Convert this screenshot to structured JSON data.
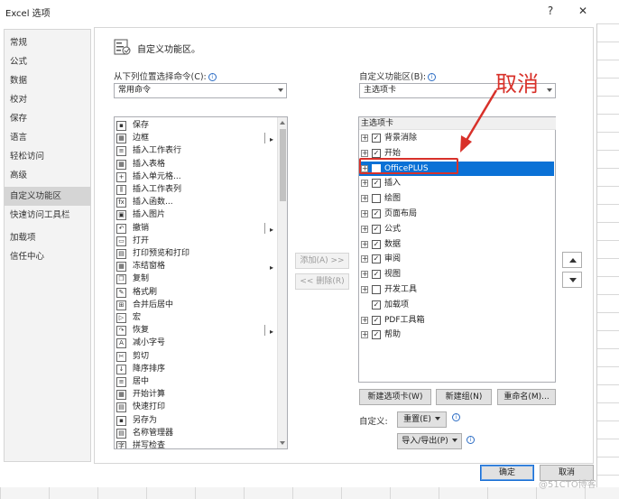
{
  "window": {
    "title": "Excel 选项",
    "help": "?",
    "close": "✕"
  },
  "nav": {
    "items": [
      {
        "label": "常规"
      },
      {
        "label": "公式"
      },
      {
        "label": "数据"
      },
      {
        "label": "校对"
      },
      {
        "label": "保存"
      },
      {
        "label": "语言"
      },
      {
        "label": "轻松访问"
      },
      {
        "label": "高级"
      },
      {
        "label": "自定义功能区",
        "active": true
      },
      {
        "label": "快速访问工具栏"
      },
      {
        "label": "加载项"
      },
      {
        "label": "信任中心"
      }
    ]
  },
  "header": {
    "title": "自定义功能区。"
  },
  "left_panel": {
    "label": "从下列位置选择命令(C):",
    "select_value": "常用命令",
    "commands": [
      {
        "label": "保存",
        "icon": "save-icon",
        "glyph": "▪"
      },
      {
        "label": "边框",
        "icon": "border-icon",
        "glyph": "▦",
        "split": true
      },
      {
        "label": "插入工作表行",
        "icon": "insert-row-icon",
        "glyph": "≡"
      },
      {
        "label": "插入表格",
        "icon": "insert-table-icon",
        "glyph": "▦"
      },
      {
        "label": "插入单元格...",
        "icon": "insert-cell-icon",
        "glyph": "+"
      },
      {
        "label": "插入工作表列",
        "icon": "insert-column-icon",
        "glyph": "⫼"
      },
      {
        "label": "插入函数...",
        "icon": "function-icon",
        "glyph": "fx"
      },
      {
        "label": "插入图片",
        "icon": "picture-icon",
        "glyph": "▣"
      },
      {
        "label": "撤销",
        "icon": "undo-icon",
        "glyph": "↶",
        "split": true
      },
      {
        "label": "打开",
        "icon": "open-icon",
        "glyph": "▭"
      },
      {
        "label": "打印预览和打印",
        "icon": "print-preview-icon",
        "glyph": "▤"
      },
      {
        "label": "冻结窗格",
        "icon": "freeze-panes-icon",
        "glyph": "▦",
        "submenu": true
      },
      {
        "label": "复制",
        "icon": "copy-icon",
        "glyph": "❐"
      },
      {
        "label": "格式刷",
        "icon": "format-painter-icon",
        "glyph": "✎"
      },
      {
        "label": "合并后居中",
        "icon": "merge-center-icon",
        "glyph": "⊞"
      },
      {
        "label": "宏",
        "icon": "macro-icon",
        "glyph": "▷"
      },
      {
        "label": "恢复",
        "icon": "redo-icon",
        "glyph": "↷",
        "split": true
      },
      {
        "label": "减小字号",
        "icon": "decrease-font-icon",
        "glyph": "A"
      },
      {
        "label": "剪切",
        "icon": "cut-icon",
        "glyph": "✂"
      },
      {
        "label": "降序排序",
        "icon": "sort-desc-icon",
        "glyph": "↓"
      },
      {
        "label": "居中",
        "icon": "center-align-icon",
        "glyph": "≡"
      },
      {
        "label": "开始计算",
        "icon": "calculate-icon",
        "glyph": "▦"
      },
      {
        "label": "快速打印",
        "icon": "quick-print-icon",
        "glyph": "▤"
      },
      {
        "label": "另存为",
        "icon": "save-as-icon",
        "glyph": "▪"
      },
      {
        "label": "名称管理器",
        "icon": "name-manager-icon",
        "glyph": "▤"
      },
      {
        "label": "拼写检查",
        "icon": "spelling-icon",
        "glyph": "字"
      }
    ]
  },
  "middle": {
    "add_label": "添加(A) >>",
    "remove_label": "<< 删除(R)"
  },
  "right_panel": {
    "label": "自定义功能区(B):",
    "select_value": "主选项卡",
    "tree_header": "主选项卡",
    "tabs": [
      {
        "label": "背景消除",
        "checked": true,
        "expand": true
      },
      {
        "label": "开始",
        "checked": true,
        "expand": true
      },
      {
        "label": "OfficePLUS",
        "checked": false,
        "expand": true,
        "selected": true
      },
      {
        "label": "插入",
        "checked": true,
        "expand": true
      },
      {
        "label": "绘图",
        "checked": false,
        "expand": true
      },
      {
        "label": "页面布局",
        "checked": true,
        "expand": true
      },
      {
        "label": "公式",
        "checked": true,
        "expand": true
      },
      {
        "label": "数据",
        "checked": true,
        "expand": true
      },
      {
        "label": "审阅",
        "checked": true,
        "expand": true
      },
      {
        "label": "视图",
        "checked": true,
        "expand": true
      },
      {
        "label": "开发工具",
        "checked": false,
        "expand": true
      },
      {
        "label": "加载项",
        "checked": true,
        "expand": false
      },
      {
        "label": "PDF工具箱",
        "checked": true,
        "expand": true
      },
      {
        "label": "帮助",
        "checked": true,
        "expand": true
      }
    ],
    "new_tab_label": "新建选项卡(W)",
    "new_group_label": "新建组(N)",
    "rename_label": "重命名(M)...",
    "custom_label": "自定义:",
    "reset_label": "重置(E)",
    "import_export_label": "导入/导出(P)"
  },
  "footer": {
    "ok_label": "确定",
    "cancel_label": "取消"
  },
  "annotation": {
    "text": "取消",
    "color": "#d8312a"
  },
  "watermark": "@51CTO博客"
}
